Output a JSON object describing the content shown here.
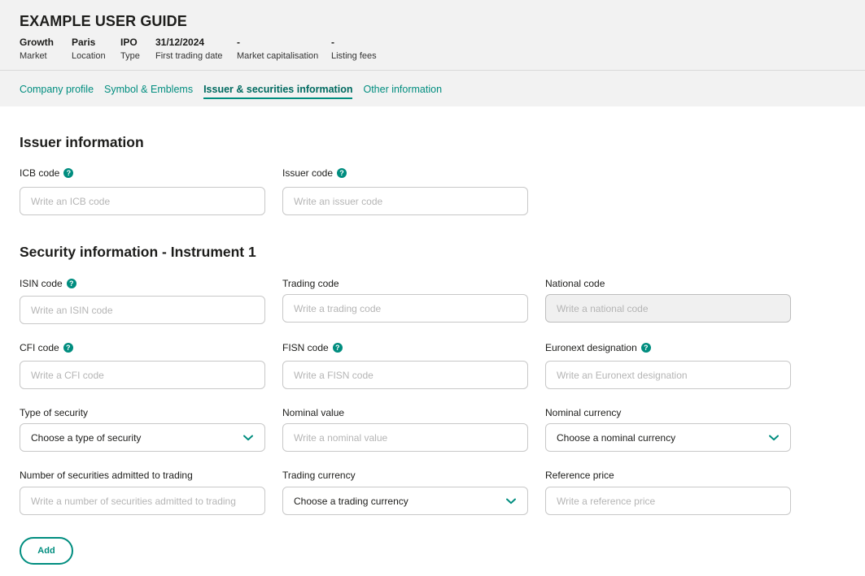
{
  "header": {
    "title": "EXAMPLE USER GUIDE",
    "meta": [
      {
        "value": "Growth",
        "label": "Market"
      },
      {
        "value": "Paris",
        "label": "Location"
      },
      {
        "value": "IPO",
        "label": "Type"
      },
      {
        "value": "31/12/2024",
        "label": "First trading date"
      },
      {
        "value": "-",
        "label": "Market capitalisation"
      },
      {
        "value": "-",
        "label": "Listing fees"
      }
    ]
  },
  "tabs": [
    {
      "label": "Company profile"
    },
    {
      "label": "Symbol & Emblems"
    },
    {
      "label": "Issuer & securities information"
    },
    {
      "label": "Other information"
    }
  ],
  "issuer": {
    "title": "Issuer information",
    "icb": {
      "label": "ICB code",
      "placeholder": "Write an ICB code"
    },
    "issuer_code": {
      "label": "Issuer code",
      "placeholder": "Write an issuer code"
    }
  },
  "security": {
    "title": "Security information - Instrument 1",
    "isin": {
      "label": "ISIN code",
      "placeholder": "Write an ISIN code"
    },
    "trading_code": {
      "label": "Trading code",
      "placeholder": "Write a trading code"
    },
    "national_code": {
      "label": "National code",
      "placeholder": "Write a national code"
    },
    "cfi": {
      "label": "CFI code",
      "placeholder": "Write a CFI code"
    },
    "fisn": {
      "label": "FISN code",
      "placeholder": "Write a FISN code"
    },
    "euronext": {
      "label": "Euronext designation",
      "placeholder": "Write an Euronext designation"
    },
    "type_of_security": {
      "label": "Type of security",
      "value": "Choose a type of security"
    },
    "nominal_value": {
      "label": "Nominal value",
      "placeholder": "Write a nominal value"
    },
    "nominal_currency": {
      "label": "Nominal currency",
      "value": "Choose a nominal currency"
    },
    "num_securities": {
      "label": "Number of securities admitted to trading",
      "placeholder": "Write a number of securities admitted to trading"
    },
    "trading_currency": {
      "label": "Trading currency",
      "value": "Choose a trading currency"
    },
    "reference_price": {
      "label": "Reference price",
      "placeholder": "Write a reference price"
    }
  },
  "actions": {
    "add_label": "Add"
  },
  "icons": {
    "help": "help-circle-icon",
    "chevron": "chevron-down-icon"
  },
  "colors": {
    "accent": "#008d7f",
    "header_bg": "#f2f2f2"
  }
}
